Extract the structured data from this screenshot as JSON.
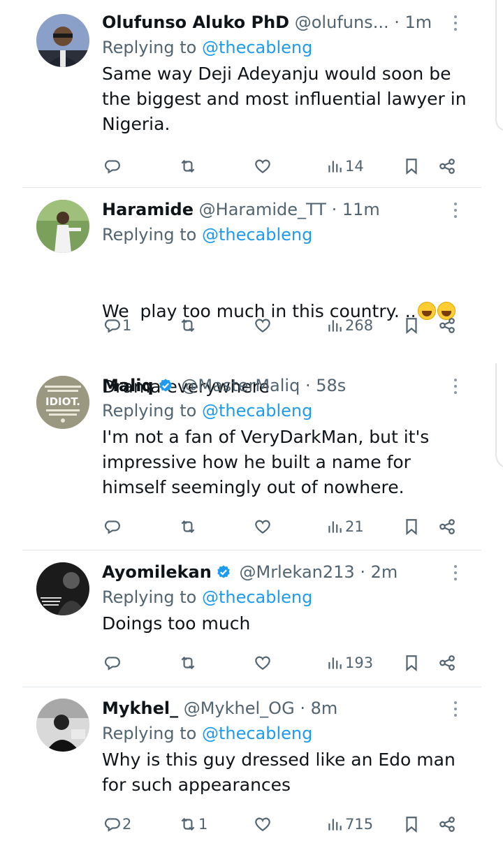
{
  "tweets": [
    {
      "name": "Olufunso Aluko PhD",
      "handle": "@olufuns...",
      "sep": "·",
      "time": "1m",
      "verified": false,
      "replying_prefix": "Replying to",
      "replying_to": "@thecableng",
      "text": "Same way Deji Adeyanju would soon be\nthe biggest and most influential lawyer in\nNigeria.",
      "emoji_count": 0,
      "replies": "",
      "retweets": "",
      "views": "14"
    },
    {
      "name": "Haramide",
      "handle": "@Haramide_TT",
      "sep": "·",
      "time": "11m",
      "verified": false,
      "replying_prefix": "Replying to",
      "replying_to": "@thecableng",
      "text": "We  play too much in this country. ..",
      "text2": "Drama everywhere",
      "emoji_count": 2,
      "replies": "1",
      "retweets": "",
      "views": "268"
    },
    {
      "name": "Maliq",
      "handle": "@MasterMaliq",
      "sep": "·",
      "time": "58s",
      "verified": true,
      "replying_prefix": "Replying to",
      "replying_to": "@thecableng",
      "text": "I'm not a fan of VeryDarkMan, but it's\nimpressive how he built a name for\nhimself seemingly out of nowhere.",
      "emoji_count": 0,
      "replies": "",
      "retweets": "",
      "views": "21",
      "avatar_text": "IDIOT."
    },
    {
      "name": "Ayomilekan",
      "handle": "@Mrlekan213",
      "sep": "·",
      "time": "2m",
      "verified": true,
      "replying_prefix": "Replying to",
      "replying_to": "@thecableng",
      "text": "Doings too much",
      "emoji_count": 0,
      "replies": "",
      "retweets": "",
      "views": "193"
    },
    {
      "name": "Mykhel_",
      "handle": "@Mykhel_OG",
      "sep": "·",
      "time": "8m",
      "verified": false,
      "replying_prefix": "Replying to",
      "replying_to": "@thecableng",
      "text": "Why is this guy dressed like an Edo man\nfor such appearances",
      "emoji_count": 0,
      "replies": "2",
      "retweets": "1",
      "views": "715"
    }
  ],
  "colors": {
    "text": "#0f1419",
    "muted": "#536471",
    "mention": "#1d9bf0",
    "verified": "#1d9bf0",
    "divider": "#e1e6ea"
  },
  "icons": {
    "reply": "reply-bubble-icon",
    "retweet": "retweet-icon",
    "like": "heart-icon",
    "views": "views-bar-chart-icon",
    "bookmark": "bookmark-icon",
    "share": "share-icon",
    "more": "more-vertical-icon",
    "verified": "verified-badge-icon"
  }
}
